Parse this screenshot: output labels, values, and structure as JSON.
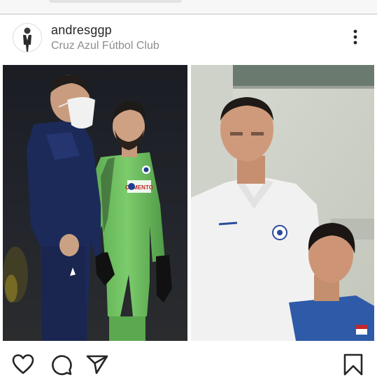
{
  "post": {
    "username": "andresggp",
    "location": "Cruz Azul Fútbol Club",
    "photo_left_logo_text": "CEMENTO"
  },
  "icons": {
    "avatar": "profile-picture",
    "more": "more-options-vertical-dots-icon",
    "like": "heart-outline-icon",
    "comment": "speech-bubble-outline-icon",
    "share": "paper-plane-icon",
    "save": "bookmark-outline-icon"
  },
  "colors": {
    "text_primary": "#262626",
    "text_secondary": "#8e8e8e",
    "divider": "#dbdbdb",
    "goalkeeper_kit": "#6fbf62",
    "coach_jacket": "#1c2a5a"
  }
}
